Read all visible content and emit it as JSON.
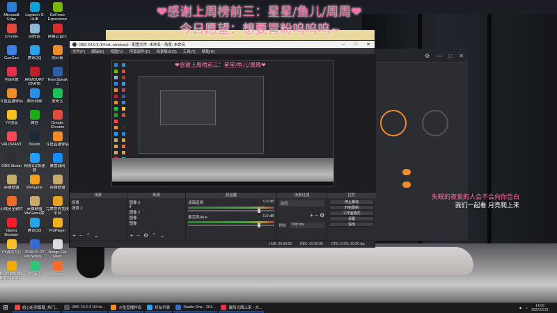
{
  "desktop": {
    "icons": [
      {
        "label": "Microsoft Edge",
        "color": "#2a7fd4"
      },
      {
        "label": "Logitech G HUB",
        "color": "#11a0d8"
      },
      {
        "label": "GeForce Experience",
        "color": "#76b900"
      },
      {
        "label": "Chrome",
        "color": "#e24b3b"
      },
      {
        "label": "回收站",
        "color": "#8fb7d8"
      },
      {
        "label": "网易云音乐",
        "color": "#d92c2c"
      },
      {
        "label": "GeeGee",
        "color": "#3f7fe0"
      },
      {
        "label": "腾讯QQ",
        "color": "#2aa4e8"
      },
      {
        "label": "向日葵",
        "color": "#f08a2a"
      },
      {
        "label": "全民K歌",
        "color": "#e2324b"
      },
      {
        "label": "ARMOURY CRATE",
        "color": "#c0202a"
      },
      {
        "label": "TeamSpeak 3",
        "color": "#2a5fa8"
      },
      {
        "label": "斗鱼直播伴侣",
        "color": "#f28c28"
      },
      {
        "label": "腾讯视频",
        "color": "#2a8fe8"
      },
      {
        "label": "爱奇艺",
        "color": "#19c35a"
      },
      {
        "label": "YY语音",
        "color": "#f4c025"
      },
      {
        "label": "微信",
        "color": "#1aad19"
      },
      {
        "label": "Google Chrome",
        "color": "#e24b3b"
      },
      {
        "label": "VALORANT",
        "color": "#ff4655"
      },
      {
        "label": "Steam",
        "color": "#1b2838"
      },
      {
        "label": "斗鱼直播伴侣",
        "color": "#f28c28"
      },
      {
        "label": "OBS Studio",
        "color": "#302e31"
      },
      {
        "label": "网易UU加速器",
        "color": "#1ea0ff"
      },
      {
        "label": "暴雪战网",
        "color": "#148eff"
      },
      {
        "label": "英雄联盟",
        "color": "#c8aa6e"
      },
      {
        "label": "WeGame",
        "color": "#f0a020"
      },
      {
        "label": "英雄联盟",
        "color": "#c8aa6e"
      },
      {
        "label": "火绒安全软件",
        "color": "#f06a2a"
      },
      {
        "label": "英雄联盟WeGame版",
        "color": "#c8aa6e"
      },
      {
        "label": "完美世界竞技平台",
        "color": "#e8a020"
      },
      {
        "label": "Opera Browser",
        "color": "#ff1b2d"
      },
      {
        "label": "腾讯QQ",
        "color": "#2aa4e8"
      },
      {
        "label": "PotPlayer",
        "color": "#f0b020"
      },
      {
        "label": "YY游戏大厅",
        "color": "#f4c025"
      },
      {
        "label": "2018-07-27 PreSonus...",
        "color": "#3a6ad0"
      },
      {
        "label": "Bongo Cat Mver",
        "color": "#dddddd"
      },
      {
        "label": "PLAYERUNKNOWN'S BATTLEGR...",
        "color": "#f2a900"
      },
      {
        "label": "QQ音乐",
        "color": "#31c27c"
      },
      {
        "label": "Origin",
        "color": "#f56c2d"
      }
    ]
  },
  "overlays": {
    "line1": "❤感谢上周榜前三：星星/鱼儿/周周❤",
    "line2": "今日愿望：想要冒粉呜呜呜~",
    "corner_line1": "失眠的夜爱的人会不会向你告白",
    "corner_line2": "我们一起看 月亮爬上来"
  },
  "obs": {
    "title": "OBS 24.0.3 (64-bit, windows) - 配置文件: 未命名 - 场景: 未命名",
    "menu": [
      "文件(F)",
      "编辑(E)",
      "视图(V)",
      "停靠部件(D)",
      "场景集合(S)",
      "工具(T)",
      "帮助(H)"
    ],
    "preview_overlay": "❤感谢上周榜前三：星星/鱼儿/周周❤",
    "scenes": {
      "header": "场景",
      "items": [
        "场景",
        "场景 2"
      ]
    },
    "sources": {
      "header": "来源",
      "items": [
        "图像 3",
        "4",
        "图像 2",
        "图像",
        "图像"
      ]
    },
    "mixer": {
      "header": "混音器",
      "channels": [
        {
          "name": "桌面音频",
          "value": "0.0 dB"
        },
        {
          "name": "麦克风/Aux",
          "value": "0.0 dB"
        }
      ]
    },
    "transitions": {
      "header": "场景过渡",
      "type": "淡出",
      "duration_label": "时长",
      "duration": "300 ms"
    },
    "controls": {
      "header": "控件",
      "buttons": [
        "停止推流",
        "开始录制",
        "工作室模式",
        "设置",
        "退出"
      ]
    },
    "status": {
      "live": "LIVE: 00:00:00",
      "rec": "REC: 00:00:00",
      "cpu": "CPU: 6.9%, 60.00 fps"
    }
  },
  "taskbar": {
    "items": [
      {
        "label": "给心姐添篇幕_热门...",
        "color": "#e24b3b"
      },
      {
        "label": "OBS 24.0.3 (64-bi...",
        "color": "#555555"
      },
      {
        "label": "斗鱼直播伴侣",
        "color": "#f28c28"
      },
      {
        "label": "好友列表",
        "color": "#2aa4e8"
      },
      {
        "label": "Studio One - 201...",
        "color": "#3a6ad0"
      },
      {
        "label": "晨阳光晒上来 - 大...",
        "color": "#e2324b"
      }
    ],
    "time": "14:05",
    "date": "2022/12/21"
  }
}
